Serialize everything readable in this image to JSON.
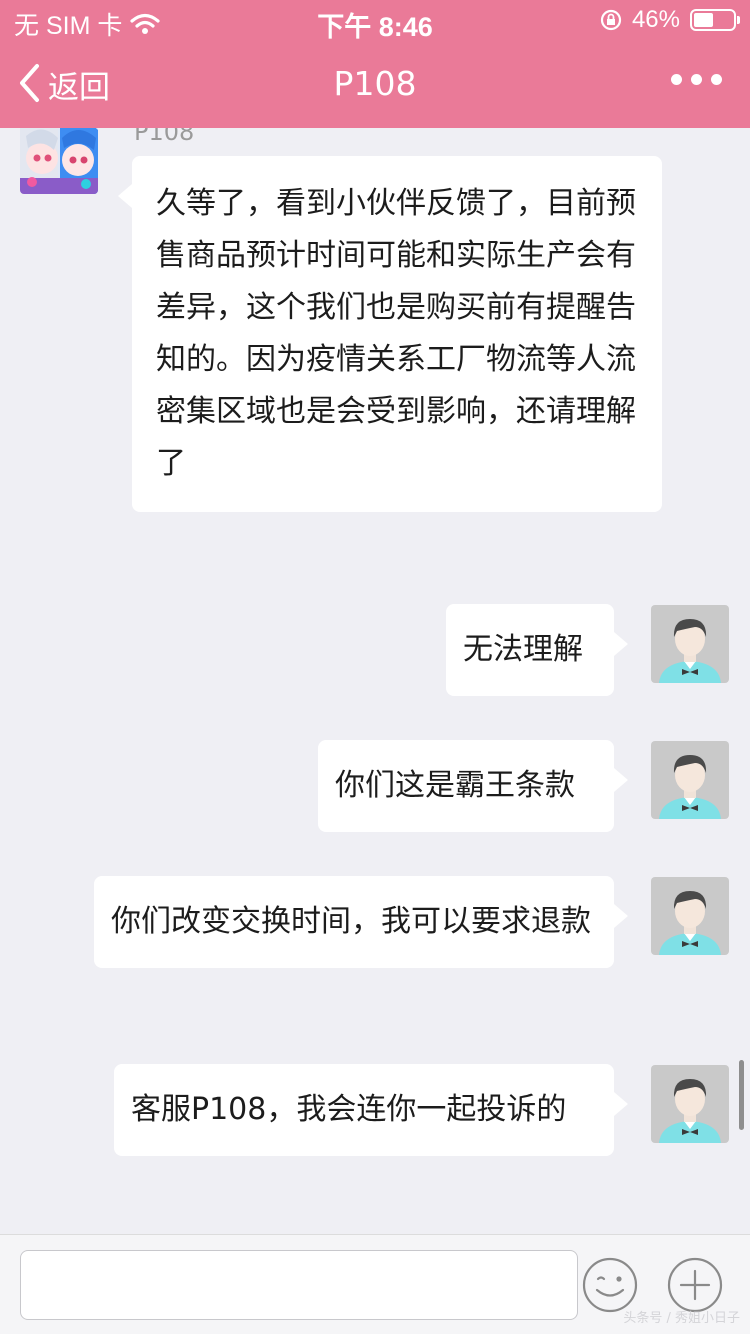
{
  "status_bar": {
    "carrier": "无 SIM 卡",
    "time": "下午 8:46",
    "battery": "46%",
    "battery_level": 0.46
  },
  "nav": {
    "back_label": "返回",
    "title": "P108",
    "more_icon": "ellipsis-icon"
  },
  "chat": {
    "agent_name": "P108",
    "messages": [
      {
        "side": "left",
        "text": "久等了，看到小伙伴反馈了，目前预售商品预计时间可能和实际生产会有差异，这个我们也是购买前有提醒告知的。因为疫情关系工厂物流等人流密集区域也是会受到影响，还请理解了"
      },
      {
        "side": "right",
        "text": "无法理解"
      },
      {
        "side": "right",
        "text": "你们这是霸王条款"
      },
      {
        "side": "right",
        "text": "你们改变交换时间，我可以要求退款"
      },
      {
        "side": "right",
        "text": "客服P108，我会连你一起投诉的"
      }
    ]
  },
  "input_bar": {
    "placeholder": "",
    "emoji_icon": "smiley-icon",
    "plus_icon": "plus-circle-icon",
    "watermark": "头条号 / 秀姐小日子"
  },
  "colors": {
    "accent": "#ea7a98",
    "background": "#efeff4",
    "bubble": "#ffffff"
  }
}
